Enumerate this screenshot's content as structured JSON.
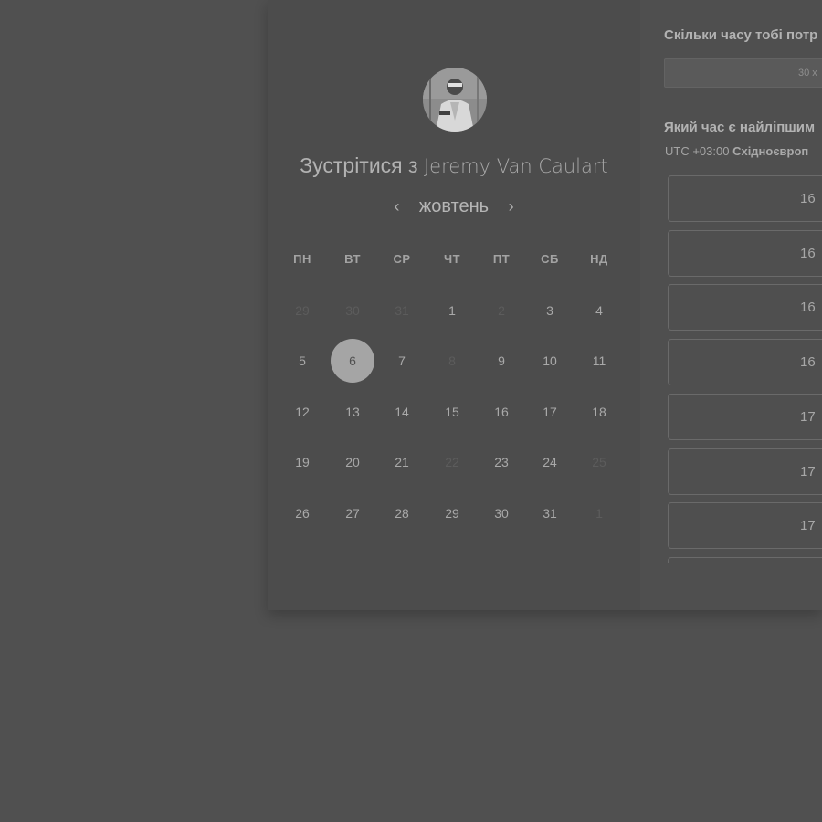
{
  "header": {
    "title_prefix": "Зустрітися з",
    "host_name": "Jeremy Van Caulart"
  },
  "calendar": {
    "month": "жовтень",
    "prev_icon": "chevron-left-icon",
    "next_icon": "chevron-right-icon",
    "weekdays": [
      "ПН",
      "ВТ",
      "СР",
      "ЧТ",
      "ПТ",
      "СБ",
      "НД"
    ],
    "weeks": [
      [
        {
          "label": "29",
          "muted": true
        },
        {
          "label": "30",
          "muted": true
        },
        {
          "label": "31",
          "muted": true
        },
        {
          "label": "1",
          "muted": false
        },
        {
          "label": "2",
          "muted": true
        },
        {
          "label": "3",
          "muted": false
        },
        {
          "label": "4",
          "muted": false
        }
      ],
      [
        {
          "label": "5",
          "muted": false
        },
        {
          "label": "6",
          "muted": false,
          "selected": true
        },
        {
          "label": "7",
          "muted": false
        },
        {
          "label": "8",
          "muted": true
        },
        {
          "label": "9",
          "muted": false
        },
        {
          "label": "10",
          "muted": false
        },
        {
          "label": "11",
          "muted": false
        }
      ],
      [
        {
          "label": "12",
          "muted": false
        },
        {
          "label": "13",
          "muted": false
        },
        {
          "label": "14",
          "muted": false
        },
        {
          "label": "15",
          "muted": false
        },
        {
          "label": "16",
          "muted": false
        },
        {
          "label": "17",
          "muted": false
        },
        {
          "label": "18",
          "muted": false
        }
      ],
      [
        {
          "label": "19",
          "muted": false
        },
        {
          "label": "20",
          "muted": false
        },
        {
          "label": "21",
          "muted": false
        },
        {
          "label": "22",
          "muted": true
        },
        {
          "label": "23",
          "muted": false
        },
        {
          "label": "24",
          "muted": false
        },
        {
          "label": "25",
          "muted": true
        }
      ],
      [
        {
          "label": "26",
          "muted": false
        },
        {
          "label": "27",
          "muted": false
        },
        {
          "label": "28",
          "muted": false
        },
        {
          "label": "29",
          "muted": false
        },
        {
          "label": "30",
          "muted": false
        },
        {
          "label": "31",
          "muted": false
        },
        {
          "label": "1",
          "muted": true
        }
      ]
    ]
  },
  "booking": {
    "duration_question": "Скільки часу тобі потр",
    "duration_value": "30 х",
    "time_question": "Який час є найліпшим",
    "timezone_offset": "UTC +03:00",
    "timezone_name": "Східноєвроп",
    "slots": [
      "16",
      "16",
      "16",
      "16",
      "17",
      "17",
      "17",
      ""
    ]
  },
  "colors": {
    "backdrop": "#505050",
    "selected_day": "#a5a5a5"
  }
}
